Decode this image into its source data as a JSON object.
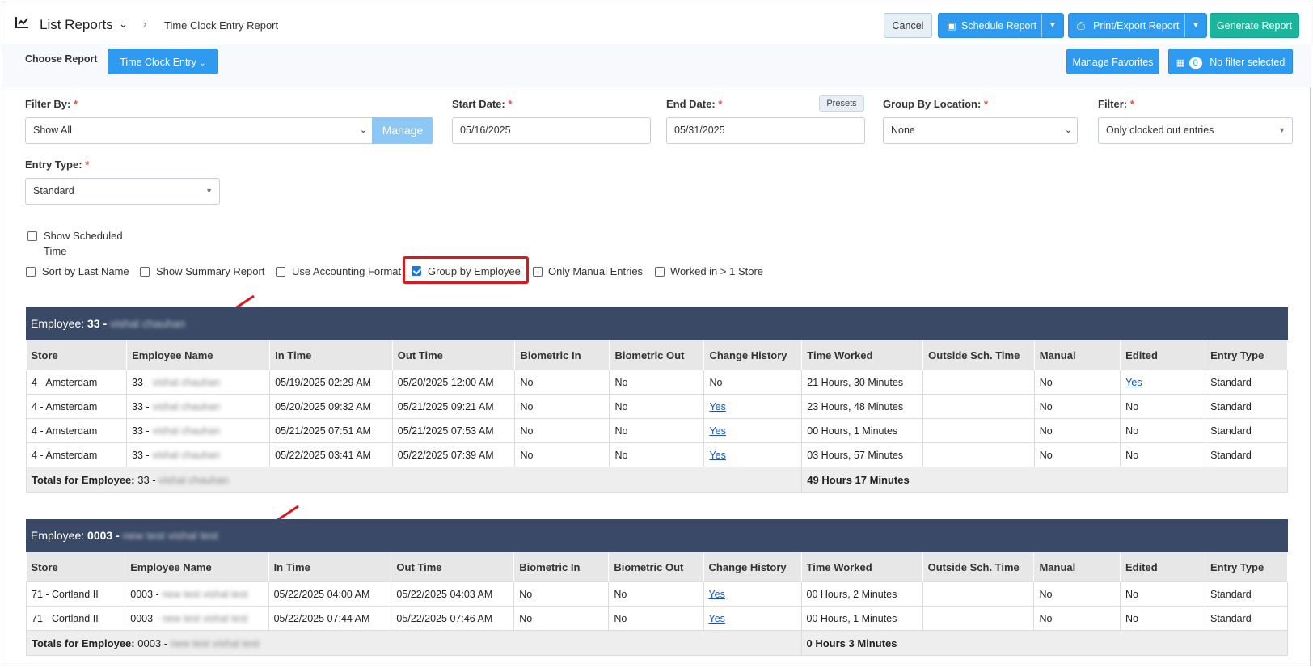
{
  "header": {
    "title": "List Reports",
    "breadcrumb": "Time Clock Entry Report",
    "cancel": "Cancel",
    "schedule": "Schedule Report",
    "print": "Print/Export Report",
    "generate": "Generate Report"
  },
  "subheader": {
    "choose_label": "Choose Report",
    "report_select": "Time Clock Entry",
    "manage_favorites": "Manage Favorites",
    "filter_count": "0",
    "filter_text": "No filter selected"
  },
  "form": {
    "filter_by_label": "Filter By:",
    "filter_by_value": "Show All",
    "manage": "Manage",
    "start_label": "Start Date:",
    "start_value": "05/16/2025",
    "end_label": "End Date:",
    "end_value": "05/31/2025",
    "presets": "Presets",
    "group_loc_label": "Group By Location:",
    "group_loc_value": "None",
    "filter_label": "Filter:",
    "filter_value": "Only clocked out entries",
    "entry_type_label": "Entry Type:",
    "entry_type_value": "Standard",
    "required_mark": "*"
  },
  "options": {
    "show_scheduled_1": "Show Scheduled",
    "show_scheduled_2": "Time",
    "sort_last": "Sort by Last Name",
    "summary": "Show Summary Report",
    "accounting": "Use Accounting Format",
    "group_emp": "Group by Employee",
    "manual_only": "Only Manual Entries",
    "worked_multi": "Worked in > 1 Store"
  },
  "columns": [
    "Store",
    "Employee Name",
    "In Time",
    "Out Time",
    "Biometric In",
    "Biometric Out",
    "Change History",
    "Time Worked",
    "Outside Sch. Time",
    "Manual",
    "Edited",
    "Entry Type"
  ],
  "groups": [
    {
      "label": "Employee:",
      "id": "33 -",
      "name": "vishal chauhan",
      "totals_label": "Totals for Employee:",
      "totals_id": "33 -",
      "totals_name": "vishal chauhan",
      "total": "49 Hours 17 Minutes",
      "rows": [
        {
          "store": "4 - Amsterdam",
          "emp_id": "33 -",
          "emp_name": "vishal chauhan",
          "in": "05/19/2025 02:29 AM",
          "out": "05/20/2025 12:00 AM",
          "bio_in": "No",
          "bio_out": "No",
          "change": "No",
          "worked": "21 Hours, 30 Minutes",
          "outside": "",
          "manual": "No",
          "edited": "Yes",
          "entry": "Standard"
        },
        {
          "store": "4 - Amsterdam",
          "emp_id": "33 -",
          "emp_name": "vishal chauhan",
          "in": "05/20/2025 09:32 AM",
          "out": "05/21/2025 09:21 AM",
          "bio_in": "No",
          "bio_out": "No",
          "change": "Yes",
          "worked": "23 Hours, 48 Minutes",
          "outside": "",
          "manual": "No",
          "edited": "No",
          "entry": "Standard"
        },
        {
          "store": "4 - Amsterdam",
          "emp_id": "33 -",
          "emp_name": "vishal chauhan",
          "in": "05/21/2025 07:51 AM",
          "out": "05/21/2025 07:53 AM",
          "bio_in": "No",
          "bio_out": "No",
          "change": "Yes",
          "worked": "00 Hours, 1 Minutes",
          "outside": "",
          "manual": "No",
          "edited": "No",
          "entry": "Standard"
        },
        {
          "store": "4 - Amsterdam",
          "emp_id": "33 -",
          "emp_name": "vishal chauhan",
          "in": "05/22/2025 03:41 AM",
          "out": "05/22/2025 07:39 AM",
          "bio_in": "No",
          "bio_out": "No",
          "change": "Yes",
          "worked": "03 Hours, 57 Minutes",
          "outside": "",
          "manual": "No",
          "edited": "No",
          "entry": "Standard"
        }
      ]
    },
    {
      "label": "Employee:",
      "id": "0003 -",
      "name": "new test vishal test",
      "totals_label": "Totals for Employee:",
      "totals_id": "0003 -",
      "totals_name": "new test vishal test",
      "total": "0 Hours 3 Minutes",
      "rows": [
        {
          "store": "71 - Cortland II",
          "emp_id": "0003 -",
          "emp_name": "new test vishal test",
          "in": "05/22/2025 04:00 AM",
          "out": "05/22/2025 04:03 AM",
          "bio_in": "No",
          "bio_out": "No",
          "change": "Yes",
          "worked": "00 Hours, 2 Minutes",
          "outside": "",
          "manual": "No",
          "edited": "No",
          "entry": "Standard"
        },
        {
          "store": "71 - Cortland II",
          "emp_id": "0003 -",
          "emp_name": "new test vishal test",
          "in": "05/22/2025 07:44 AM",
          "out": "05/22/2025 07:46 AM",
          "bio_in": "No",
          "bio_out": "No",
          "change": "Yes",
          "worked": "00 Hours, 1 Minutes",
          "outside": "",
          "manual": "No",
          "edited": "No",
          "entry": "Standard"
        }
      ]
    }
  ],
  "colors": {
    "accent": "#2f9bf0",
    "teal": "#1bb59b",
    "group_header": "#394966",
    "highlight": "#e0151d"
  }
}
